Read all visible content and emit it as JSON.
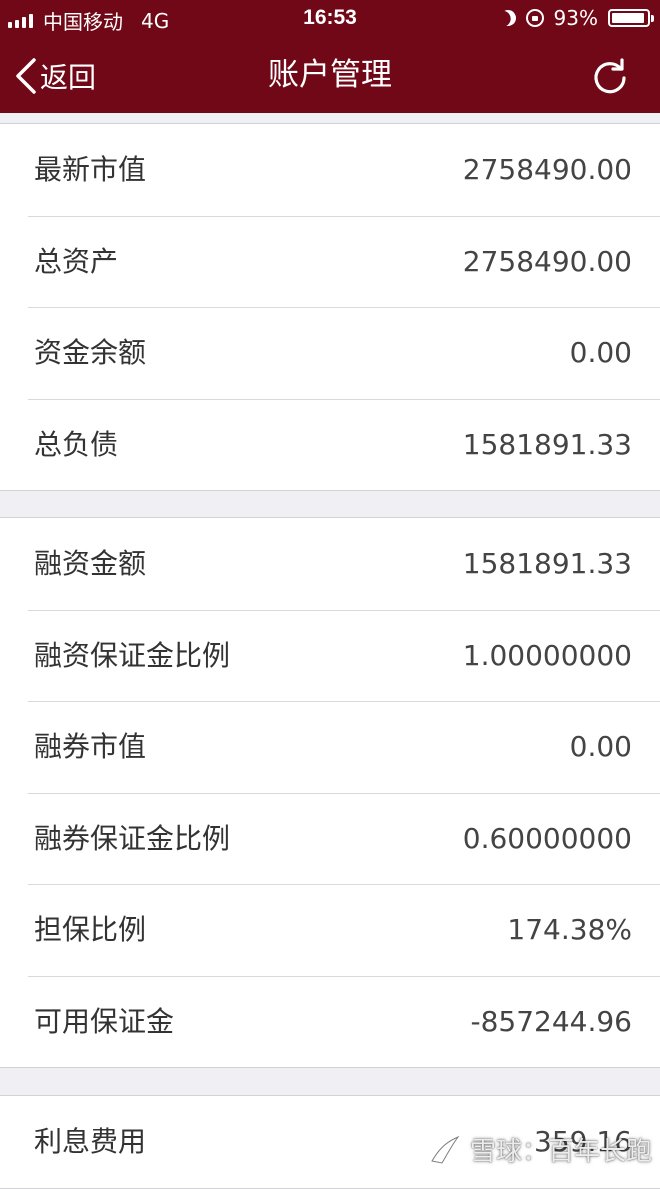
{
  "status_bar": {
    "carrier": "中国移动",
    "network": "4G",
    "time": "16:53",
    "battery_percent": "93%",
    "battery_level": 0.93
  },
  "nav": {
    "back_label": "返回",
    "title": "账户管理",
    "icons": {
      "back": "chevron-left-icon",
      "refresh": "refresh-icon"
    }
  },
  "sections": [
    {
      "rows": [
        {
          "label": "最新市值",
          "value": "2758490.00"
        },
        {
          "label": "总资产",
          "value": "2758490.00"
        },
        {
          "label": "资金余额",
          "value": "0.00"
        },
        {
          "label": "总负债",
          "value": "1581891.33"
        }
      ]
    },
    {
      "rows": [
        {
          "label": "融资金额",
          "value": "1581891.33"
        },
        {
          "label": "融资保证金比例",
          "value": "1.00000000"
        },
        {
          "label": "融券市值",
          "value": "0.00"
        },
        {
          "label": "融券保证金比例",
          "value": "0.60000000"
        },
        {
          "label": "担保比例",
          "value": "174.38%"
        },
        {
          "label": "可用保证金",
          "value": "-857244.96"
        }
      ]
    },
    {
      "rows": [
        {
          "label": "利息费用",
          "value": "359.16"
        }
      ]
    }
  ],
  "watermark": {
    "text": "雪球：百年长跑",
    "icon": "snowball-logo-icon"
  },
  "colors": {
    "header_bg": "#700817",
    "page_bg": "#efeff4",
    "row_bg": "#ffffff",
    "text": "#333333"
  }
}
